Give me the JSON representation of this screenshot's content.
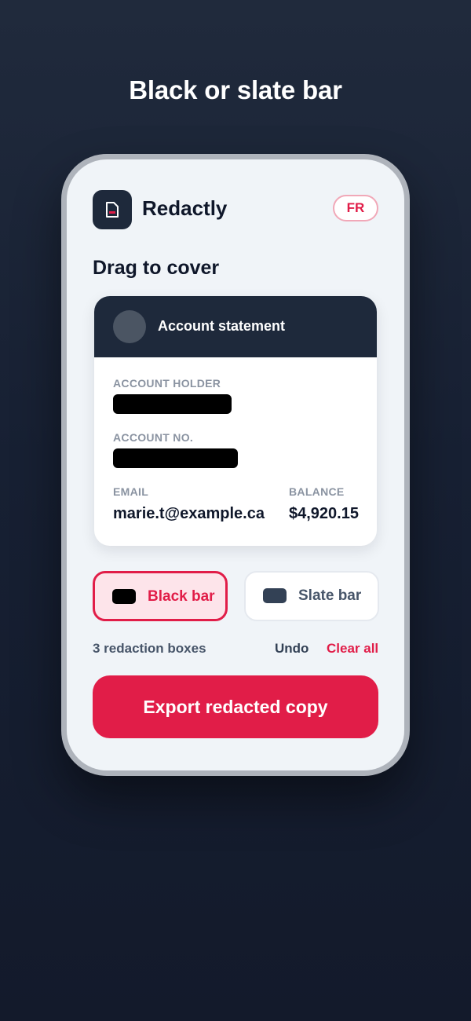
{
  "headline": "Black or slate bar",
  "app": {
    "name": "Redactly",
    "language_toggle": "FR",
    "logo_icon": "document-redact-icon"
  },
  "section_title": "Drag to cover",
  "document": {
    "title": "Account statement",
    "fields": {
      "account_holder_label": "ACCOUNT HOLDER",
      "account_no_label": "ACCOUNT NO.",
      "email_label": "EMAIL",
      "email_value": "marie.t@example.ca",
      "balance_label": "BALANCE",
      "balance_value": "$4,920.15"
    }
  },
  "redaction_styles": [
    {
      "label": "Black bar",
      "swatch_color": "#000000",
      "selected": true
    },
    {
      "label": "Slate bar",
      "swatch_color": "#334155",
      "selected": false
    }
  ],
  "status": {
    "count_text": "3 redaction boxes",
    "undo_label": "Undo",
    "clear_label": "Clear all"
  },
  "export_label": "Export redacted copy",
  "colors": {
    "accent": "#e11d48",
    "dark": "#1e293b",
    "background": "#172033"
  }
}
